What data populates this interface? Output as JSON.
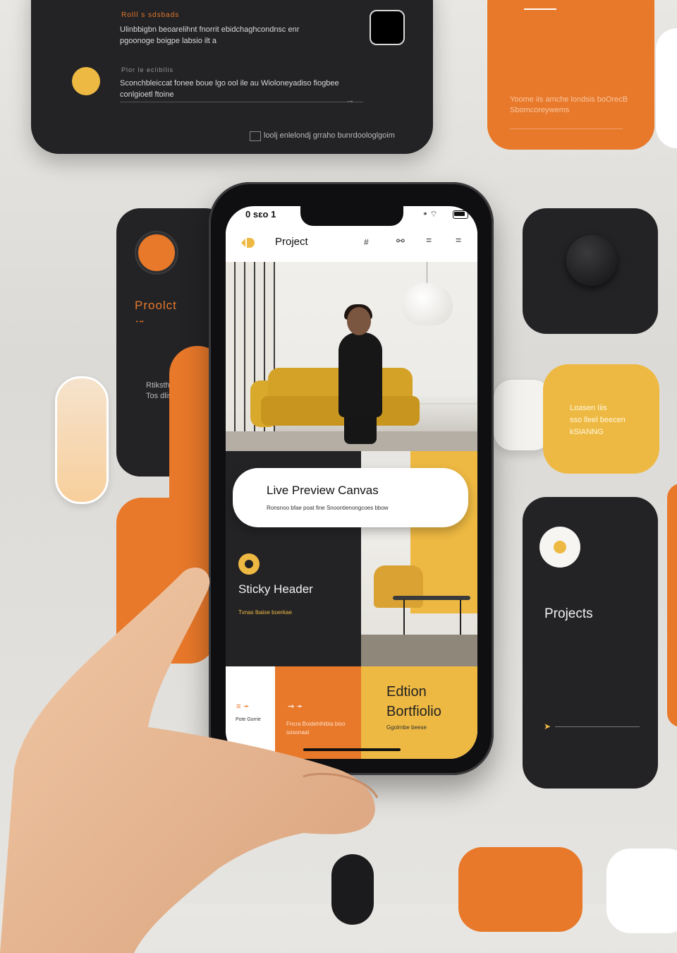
{
  "background_cards": {
    "top_left": {
      "eyebrow": "Rolll s sdsbads",
      "body": "Ulinbbigbn beoarelihnt fnorrit ebidchaghcondnsc enr pgoonoge boigpe labsio ilt a",
      "eyebrow2": "Plor le eclibllis",
      "body2": "Sconchbleiccat fonee boue lgo ool ile au Wioloneyadiso fiogbee conlgioetl ftoine",
      "footer": "loolj enlelondj grraho bunrdoologlgoim"
    },
    "top_right": {
      "text": "Yoome iis amche londsis boOrecB Sbomcoreywems"
    },
    "left_dark": {
      "title": "Proolct",
      "subtitle": "• ••",
      "text": "Rtiksthe\nTos dlise"
    },
    "right_yellow": {
      "text": "Loasen Iiis\nsso lleel beecen\nkSIANNG"
    },
    "right_dark": {
      "title": "Projects"
    }
  },
  "phone": {
    "status": {
      "time": "0 sɛo 1",
      "right": "⁍ ⌔"
    },
    "appbar": {
      "name": "Project",
      "icons": [
        "hash-icon",
        "link-icon",
        "menu-icon",
        "hamburger-icon"
      ],
      "icon_glyphs": [
        "#",
        "⚯",
        "=",
        "="
      ]
    },
    "preview": {
      "title": "Live Preview Canvas",
      "subtitle": "Ronsnoo bfae poat fine Snoontienongcoes bbow"
    },
    "sticky": {
      "title": "Sticky Header",
      "subtitle": "Tvnas lbaise boerkae"
    },
    "tiles": {
      "tile1_icon": "≡ ➛",
      "tile1_caption": "Pote Gorrie",
      "tile2_icon": "⇝ ➛",
      "tile2_caption": "Fncra Boidehihibta biso sosonaat",
      "tile3_title_line1": "Edtion",
      "tile3_title_line2": "Bortfiolio",
      "tile3_caption": "Ggolrnbe beese"
    }
  },
  "colors": {
    "dark": "#232326",
    "orange": "#e8782a",
    "yellow": "#eeb942",
    "white": "#f6f5f2"
  }
}
